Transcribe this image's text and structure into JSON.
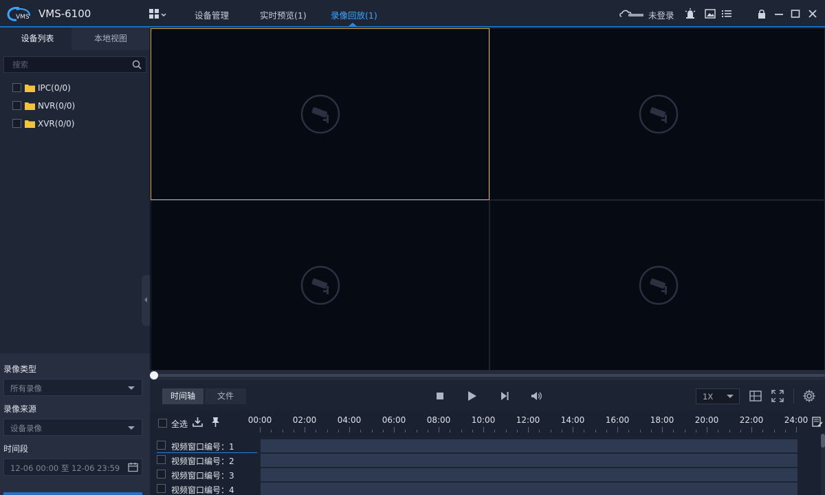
{
  "app": {
    "name": "VMS-6100",
    "logo_text": "VMS"
  },
  "nav": [
    {
      "label": "设备管理"
    },
    {
      "label": "实时预览(1)"
    },
    {
      "label": "录像回放(1)"
    }
  ],
  "header": {
    "login_text": "未登录"
  },
  "colors": {
    "accent": "#3aa6ff",
    "selected_border": "#e0b24a",
    "folder": "#f5c33b"
  },
  "left_panel": {
    "tabs": [
      {
        "label": "设备列表"
      },
      {
        "label": "本地视图"
      }
    ],
    "search": {
      "placeholder": "搜索",
      "value": ""
    },
    "tree": [
      {
        "label": "IPC(0/0)"
      },
      {
        "label": "NVR(0/0)"
      },
      {
        "label": "XVR(0/0)"
      }
    ],
    "filters": {
      "record_type_label": "录像类型",
      "record_type_value": "所有录像",
      "record_source_label": "录像来源",
      "record_source_value": "设备录像",
      "time_range_label": "时间段",
      "time_range_value": "12-06 00:00 至 12-06 23:59"
    }
  },
  "playback": {
    "mode_tabs": [
      {
        "label": "时间轴"
      },
      {
        "label": "文件"
      }
    ],
    "speed": "1X"
  },
  "timeline": {
    "select_all_label": "全选",
    "hours": [
      "00:00",
      "02:00",
      "04:00",
      "06:00",
      "08:00",
      "10:00",
      "12:00",
      "14:00",
      "16:00",
      "18:00",
      "20:00",
      "22:00",
      "24:00"
    ],
    "channels": [
      {
        "label": "视频窗口编号：1"
      },
      {
        "label": "视频窗口编号：2"
      },
      {
        "label": "视频窗口编号：3"
      },
      {
        "label": "视频窗口编号：4"
      }
    ]
  }
}
